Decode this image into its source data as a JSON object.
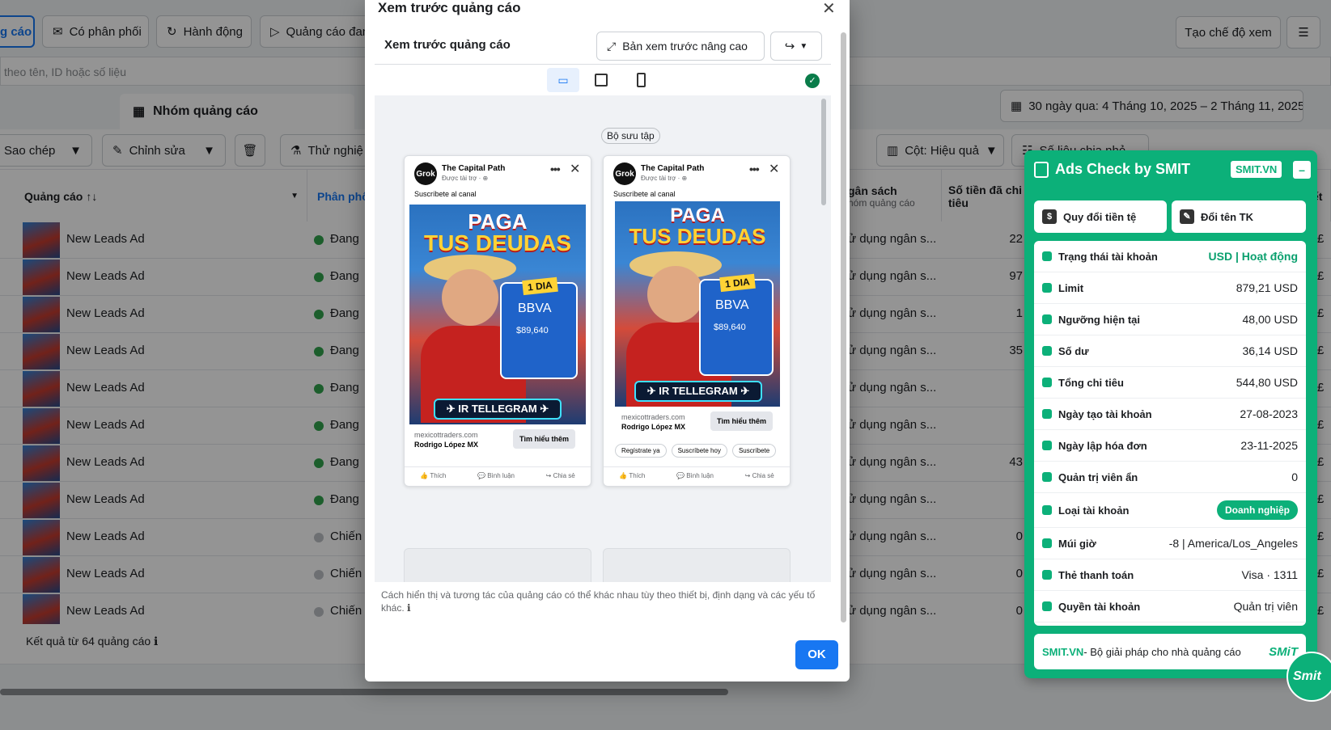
{
  "toolbar": {
    "tab_ads": "g cáo",
    "tab_delivery": "Có phân phối",
    "tab_actions": "Hành động",
    "tab_running": "Quảng cáo đan",
    "create_view": "Tạo chế độ xem",
    "search_placeholder": "theo tên, ID hoặc số liệu",
    "date_range": "30 ngày qua: 4 Tháng 10, 2025 – 2 Tháng 11, 2025",
    "adset_tab": "Nhóm quảng cáo",
    "copy": "Sao chép",
    "edit": "Chỉnh sửa",
    "test": "Thử nghiệ",
    "columns": "Cột: Hiệu quả",
    "breakdown": "Số liệu chia nhỏ"
  },
  "table": {
    "col_ad": "Quảng cáo",
    "col_delivery": "Phân phố",
    "col_budget": "gân sách",
    "col_budget_sub": "hóm quảng cáo",
    "col_spent": "Số tiền đã chi",
    "col_spent_sub": "tiêu",
    "col_last": "ết",
    "rows": [
      {
        "name": "New Leads Ad",
        "status": "Đang h",
        "budget": "ử dụng ngân s...",
        "amount": "22",
        "cur": "£"
      },
      {
        "name": "New Leads Ad",
        "status": "Đang h",
        "budget": "ử dụng ngân s...",
        "amount": "97",
        "cur": "£"
      },
      {
        "name": "New Leads Ad",
        "status": "Đang h",
        "budget": "ử dụng ngân s...",
        "amount": "1",
        "cur": "£"
      },
      {
        "name": "New Leads Ad",
        "status": "Đang h",
        "budget": "ử dụng ngân s...",
        "amount": "35",
        "cur": "£"
      },
      {
        "name": "New Leads Ad",
        "status": "Đang h",
        "budget": "ử dụng ngân s...",
        "amount": "",
        "cur": "£"
      },
      {
        "name": "New Leads Ad",
        "status": "Đang h",
        "budget": "ử dụng ngân s...",
        "amount": "",
        "cur": "£"
      },
      {
        "name": "New Leads Ad",
        "status": "Đang h",
        "budget": "ử dụng ngân s...",
        "amount": "43",
        "cur": "£"
      },
      {
        "name": "New Leads Ad",
        "status": "Đang h",
        "budget": "ử dụng ngân s...",
        "amount": "",
        "cur": "£"
      },
      {
        "name": "New Leads Ad",
        "status": "Chiến c",
        "budget": "ử dụng ngân s...",
        "amount": "0",
        "cur": "£"
      },
      {
        "name": "New Leads Ad",
        "status": "Chiến c",
        "budget": "ử dụng ngân s...",
        "amount": "0",
        "cur": "£"
      },
      {
        "name": "New Leads Ad",
        "status": "Chiến c",
        "budget": "ử dụng ngân s...",
        "amount": "0",
        "cur": "£"
      }
    ],
    "footer": "Kết quả từ 64 quảng cáo"
  },
  "modal": {
    "title": "Xem trước quảng cáo",
    "sub_title": "Xem trước quảng cáo",
    "advanced_btn": "Bản xem trước nâng cao",
    "collection_badge": "Bộ sưu tập",
    "note": "Cách hiển thị và tương tác của quảng cáo có thể khác nhau tùy theo thiết bị, định dạng và các yếu tố khác.",
    "ok": "OK",
    "ad": {
      "page_name": "The Capital Path",
      "sponsored": "Được tài trợ · ⊕",
      "caption": "Suscríbete al canal",
      "headline1": "PAGA",
      "headline2": "TUS DEUDAS",
      "badge": "1 DIA",
      "bank": "BBVA",
      "transfer_amount": "$89,640",
      "telegram": "IR TELLEGRAM",
      "domain": "mexicottraders.com",
      "advertiser": "Rodrigo López MX",
      "cta": "Tìm hiểu thêm",
      "like": "Thích",
      "comment": "Bình luận",
      "share": "Chia sẻ",
      "chips": [
        "Regístrate ya",
        "Suscríbete hoy",
        "Suscríbete"
      ]
    }
  },
  "panel": {
    "title": "Ads Check by SMIT",
    "brand_badge": "SMIT.VN",
    "btn_currency": "Quy đổi tiền tệ",
    "btn_rename": "Đổi tên TK",
    "rows": [
      {
        "label": "Trạng thái tài khoản",
        "value": "USD | Hoạt động"
      },
      {
        "label": "Limit",
        "value": "879,21 USD"
      },
      {
        "label": "Ngưỡng hiện tại",
        "value": "48,00 USD"
      },
      {
        "label": "Số dư",
        "value": "36,14 USD"
      },
      {
        "label": "Tổng chi tiêu",
        "value": "544,80 USD"
      },
      {
        "label": "Ngày tạo tài khoản",
        "value": "27-08-2023"
      },
      {
        "label": "Ngày lập hóa đơn",
        "value": "23-11-2025"
      },
      {
        "label": "Quản trị viên ẩn",
        "value": "0"
      },
      {
        "label": "Loại tài khoản",
        "value": "Doanh nghiệp"
      },
      {
        "label": "Múi giờ",
        "value": "-8 | America/Los_Angeles"
      },
      {
        "label": "Thẻ thanh toán",
        "value": "Visa · 1311"
      },
      {
        "label": "Quyền tài khoản",
        "value": "Quản trị viên"
      }
    ],
    "footer_brand": "SMIT.VN",
    "footer_text": " - Bộ giải pháp cho nhà quảng cáo",
    "footer_logo": "SMiT",
    "fab": "Smit"
  },
  "colors": {
    "accent": "#1877f2",
    "smit_green": "#0cb079",
    "ok_blue": "#1877f2"
  }
}
